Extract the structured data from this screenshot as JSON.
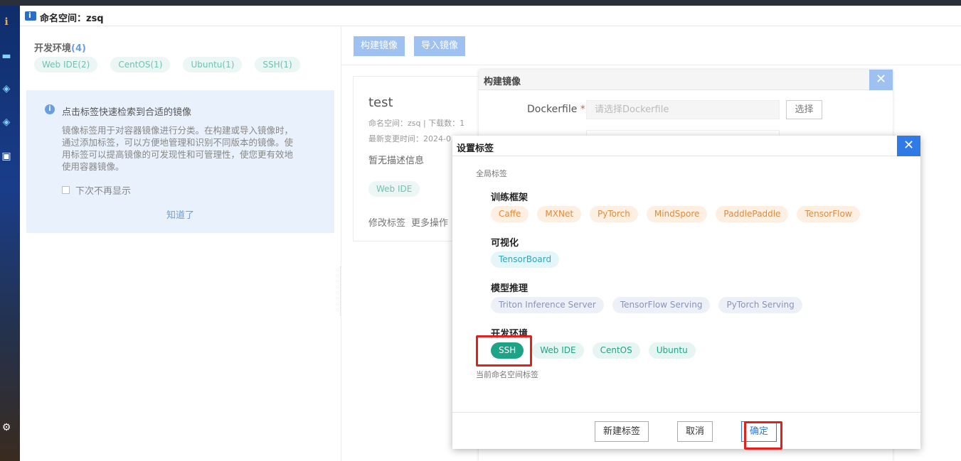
{
  "window": {
    "title": "命名空间：zsq"
  },
  "left_panel": {
    "filter_title": "开发环境",
    "filter_count": "(4)",
    "chips": [
      "Web IDE(2)",
      "CentOS(1)",
      "Ubuntu(1)",
      "SSH(1)"
    ],
    "tip": {
      "title": "点击标签快速检索到合适的镜像",
      "body": "镜像标签用于对容器镜像进行分类。在构建或导入镜像时，通过添加标签，可以方便地管理和识别不同版本的镜像。使用标签可以提高镜像的可发现性和可管理性，使您更有效地使用容器镜像。",
      "checkbox_label": "下次不再显示",
      "ok_label": "知道了"
    }
  },
  "toolbar": {
    "build_label": "构建镜像",
    "import_label": "导入镜像"
  },
  "card": {
    "title": "test",
    "meta_line1": "命名空间：zsq  |  下载数：1",
    "meta_line2": "最新变更时间：2024-0",
    "description": "暂无描述信息",
    "tag": "Web IDE",
    "edit_tags": "修改标签",
    "more_actions": "更多操作"
  },
  "build_dialog": {
    "title": "构建镜像",
    "dockerfile_label": "Dockerfile",
    "required_mark": "*",
    "dockerfile_placeholder": "请选择Dockerfile",
    "select_label": "选择"
  },
  "tag_dialog": {
    "title": "设置标签",
    "global_label": "全局标签",
    "namespace_label": "当前命名空间标签",
    "categories": [
      {
        "name": "训练框架",
        "color": "orange",
        "tags": [
          "Caffe",
          "MXNet",
          "PyTorch",
          "MindSpore",
          "PaddlePaddle",
          "TensorFlow"
        ]
      },
      {
        "name": "可视化",
        "color": "cyan",
        "tags": [
          "TensorBoard"
        ]
      },
      {
        "name": "模型推理",
        "color": "purple",
        "tags": [
          "Triton Inference Server",
          "TensorFlow Serving",
          "PyTorch Serving"
        ]
      },
      {
        "name": "开发环境",
        "color": "green",
        "tags": [
          "SSH",
          "Web IDE",
          "CentOS",
          "Ubuntu"
        ],
        "selected": "SSH"
      }
    ],
    "buttons": {
      "new_tag": "新建标签",
      "cancel": "取消",
      "confirm": "确定"
    }
  },
  "colors": {
    "primary": "#2f7ae5",
    "highlight": "#e3201b",
    "selected_tag": "#1fa387"
  }
}
